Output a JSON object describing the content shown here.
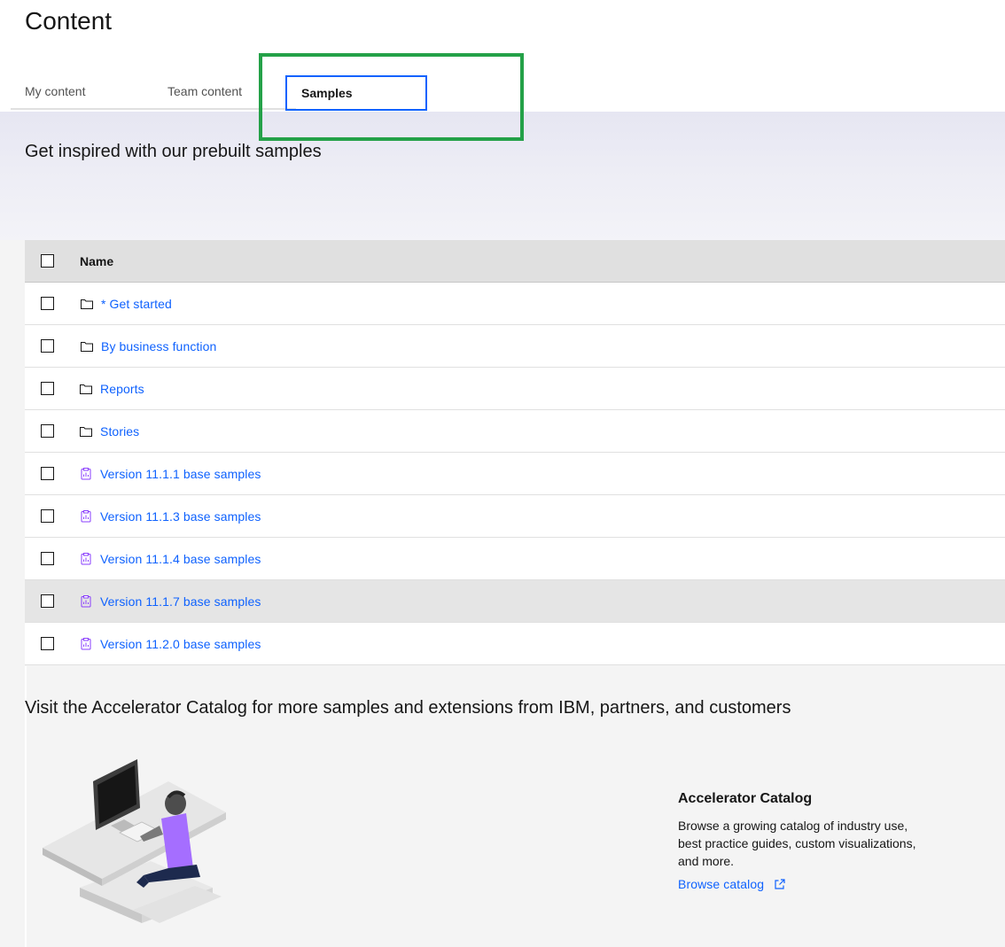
{
  "page": {
    "title": "Content"
  },
  "tabs": [
    {
      "label": "My content",
      "selected": false
    },
    {
      "label": "Team content",
      "selected": false
    },
    {
      "label": "Samples",
      "selected": true
    }
  ],
  "hero": {
    "text": "Get inspired with our prebuilt samples"
  },
  "table": {
    "header": {
      "name": "Name"
    },
    "rows": [
      {
        "label": "* Get started",
        "icon": "folder-icon"
      },
      {
        "label": "By business function",
        "icon": "folder-icon"
      },
      {
        "label": "Reports",
        "icon": "folder-icon"
      },
      {
        "label": "Stories",
        "icon": "folder-icon"
      },
      {
        "label": "Version 11.1.1 base samples",
        "icon": "package-icon"
      },
      {
        "label": "Version 11.1.3 base samples",
        "icon": "package-icon"
      },
      {
        "label": "Version 11.1.4 base samples",
        "icon": "package-icon"
      },
      {
        "label": "Version 11.1.7 base samples",
        "icon": "package-icon"
      },
      {
        "label": "Version 11.2.0 base samples",
        "icon": "package-icon"
      }
    ]
  },
  "catalog": {
    "intro": "Visit the Accelerator Catalog for more samples and extensions from IBM, partners, and customers",
    "card_title": "Accelerator Catalog",
    "card_description": "Browse a growing catalog of industry use, best practice guides, custom visualizations, and more.",
    "link_label": "Browse catalog",
    "link_icon": "launch-icon"
  },
  "colors": {
    "link": "#0f62fe",
    "highlight": "#24a148",
    "package_icon": "#8a3ffc",
    "tab_focus": "#0f62fe"
  }
}
